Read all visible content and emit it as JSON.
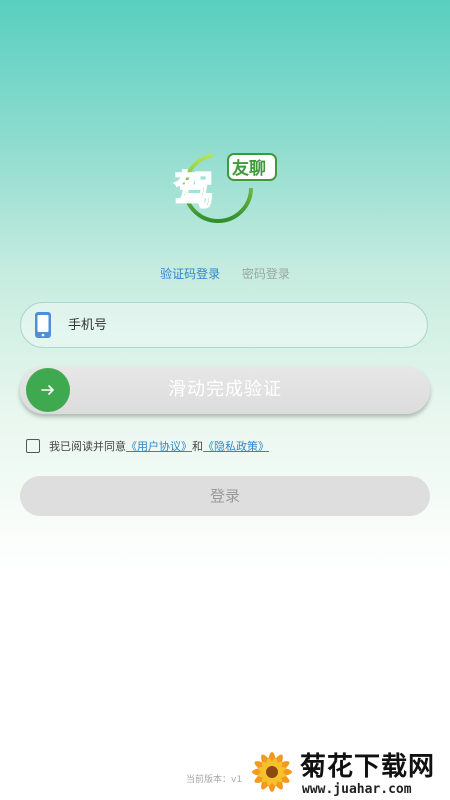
{
  "logo": {
    "main_char": "驾",
    "badge_text": "友聊"
  },
  "tabs": [
    {
      "label": "验证码登录",
      "active": true
    },
    {
      "label": "密码登录",
      "active": false
    }
  ],
  "phone_field": {
    "placeholder": "手机号",
    "value": ""
  },
  "slider": {
    "label": "滑动完成验证",
    "handle_icon": "arrow-right-icon"
  },
  "agreement": {
    "checked": false,
    "prefix": "我已阅读并同意",
    "user_agreement": "《用户协议》",
    "conjunction": "和",
    "privacy_policy": "《隐私政策》"
  },
  "login_button": {
    "label": "登录"
  },
  "footer": {
    "version_text": "当前版本：v1"
  },
  "watermark": {
    "title": "菊花下载网",
    "url": "www.juahar.com"
  },
  "colors": {
    "accent_blue": "#2f86c8",
    "slider_green": "#3fa94f",
    "logo_green": "#4caf3c"
  }
}
